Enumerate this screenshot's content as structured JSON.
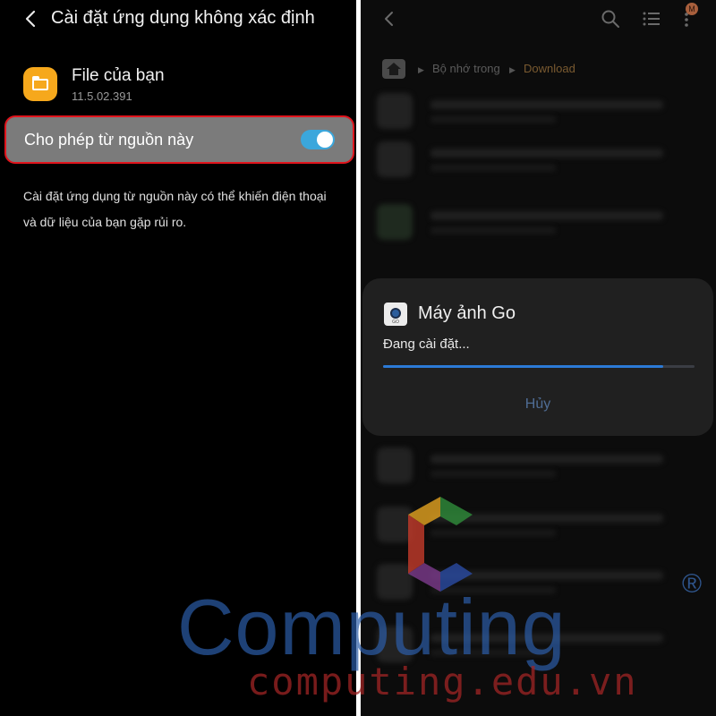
{
  "left": {
    "header": {
      "title": "Cài đặt ứng dụng không xác định"
    },
    "app": {
      "name": "File của bạn",
      "version": "11.5.02.391",
      "icon": "folder-icon",
      "icon_color": "#f6a81c"
    },
    "toggle": {
      "label": "Cho phép từ nguồn này",
      "state": "on",
      "accent": "#3ba7dc",
      "highlight_color": "#e0141c"
    },
    "warning": "Cài đặt ứng dụng từ nguồn này có thể khiến điện thoại và dữ liệu của bạn gặp rủi ro."
  },
  "right": {
    "toolbar": {
      "icons": [
        "back-icon",
        "search-icon",
        "list-view-icon",
        "more-options-icon"
      ],
      "badge": "M"
    },
    "breadcrumb": {
      "items": [
        "Bộ nhớ trong",
        "Download"
      ]
    },
    "dialog": {
      "app_name": "Máy ảnh Go",
      "icon_caption": "GO",
      "status": "Đang cài đặt...",
      "progress": 0.9,
      "cancel_label": "Hủy",
      "accent": "#2c7ad6"
    }
  },
  "watermark": {
    "brand": "Computing",
    "registered": "®",
    "url": "computing.edu.vn"
  }
}
